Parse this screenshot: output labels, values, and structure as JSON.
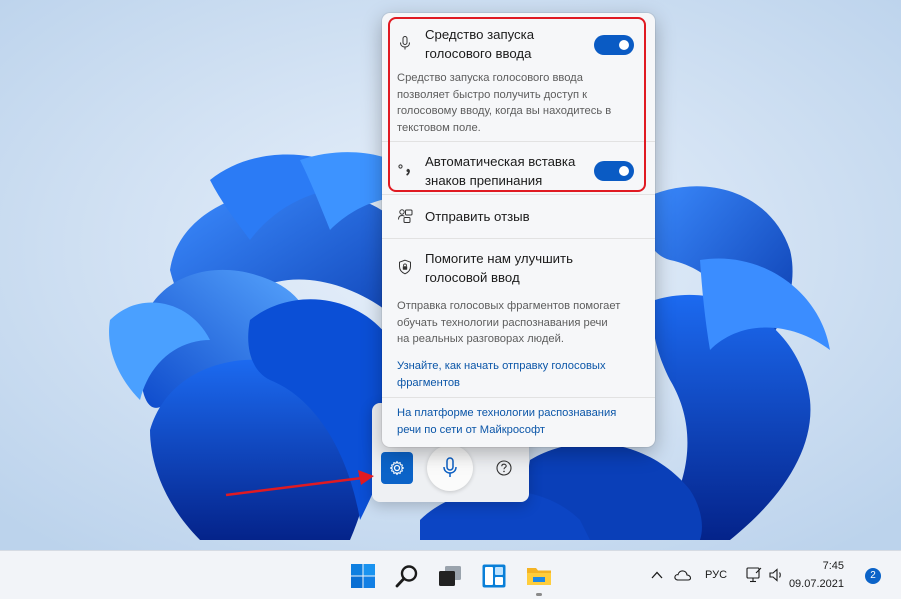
{
  "flyout": {
    "launcher": {
      "title": "Средство запуска голосового ввода",
      "title_line1": "Средство запуска",
      "title_line2": "голосового ввода",
      "description": "Средство запуска голосового ввода позволяет быстро получить доступ к голосовому вводу, когда вы находитесь в текстовом поле.",
      "desc_lines": [
        "Средство запуска голосового ввода",
        "позволяет быстро получить доступ к",
        "голосовому вводу, когда вы находитесь в",
        "текстовом поле."
      ],
      "enabled": true,
      "icon": "microphone-icon"
    },
    "punctuation": {
      "title_line1": "Автоматическая вставка",
      "title_line2": "знаков препинания",
      "enabled": true,
      "icon": "punctuation-icon"
    },
    "feedback": {
      "label": "Отправить отзыв",
      "icon": "feedback-icon"
    },
    "improve": {
      "title_line1": "Помогите нам улучшить",
      "title_line2": "голосовой ввод",
      "icon": "shield-icon",
      "desc_lines": [
        "Отправка голосовых фрагментов помогает",
        "обучать технологии распознавания речи",
        "на реальных разговорах людей."
      ],
      "link_lines": [
        "Узнайте, как начать отправку голосовых",
        "фрагментов"
      ]
    },
    "footer_link_lines": [
      "На платформе технологии распознавания",
      "речи по сети от Майкрософт"
    ]
  },
  "voicebar": {
    "settings_icon": "gear-icon",
    "mic_icon": "microphone-icon",
    "help_icon": "question-icon"
  },
  "taskbar": {
    "icons": [
      "windows-start-icon",
      "search-icon",
      "task-view-icon",
      "widgets-icon",
      "file-explorer-icon"
    ],
    "tray_icons": [
      "chevron-up-icon",
      "cloud-icon",
      "display-icon",
      "speaker-icon"
    ],
    "language": "РУС",
    "time": "7:45",
    "date": "09.07.2021",
    "notification_count": "2"
  },
  "colors": {
    "accent": "#0a5bc4",
    "highlight_red": "#e01a22",
    "link": "#0b56a8"
  }
}
